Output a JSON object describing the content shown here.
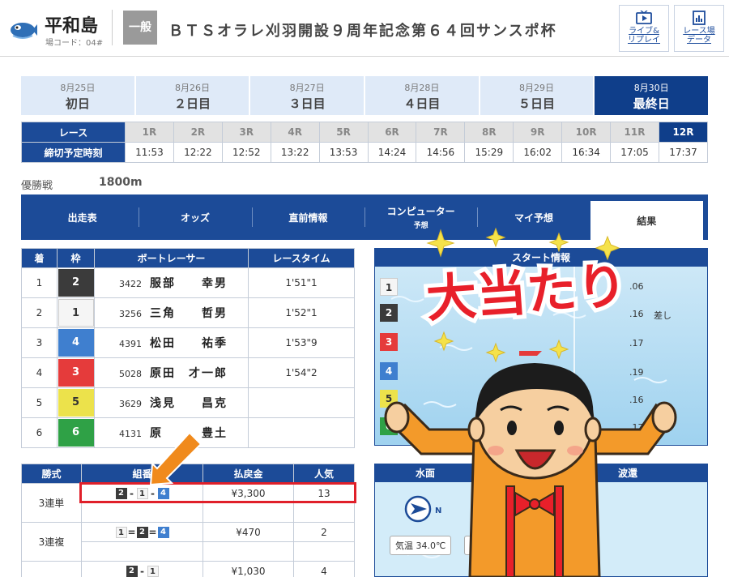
{
  "header": {
    "venue_name": "平和島",
    "venue_code": "場コード：04#",
    "grade": "一般",
    "race_title": "ＢＴＳオラレ刈羽開設９周年記念第６４回サンスポ杯",
    "buttons": [
      {
        "label_line1": "ライブ&",
        "label_line2": "リプレイ",
        "icon": "tv-icon"
      },
      {
        "label_line1": "レース場",
        "label_line2": "データ",
        "icon": "chart-icon"
      }
    ]
  },
  "days": [
    {
      "date": "8月25日",
      "name": "初日",
      "active": false
    },
    {
      "date": "8月26日",
      "name": "２日目",
      "active": false
    },
    {
      "date": "8月27日",
      "name": "３日目",
      "active": false
    },
    {
      "date": "8月28日",
      "name": "４日目",
      "active": false
    },
    {
      "date": "8月29日",
      "name": "５日目",
      "active": false
    },
    {
      "date": "8月30日",
      "name": "最終日",
      "active": true
    }
  ],
  "race_table": {
    "race_label": "レース",
    "deadline_label": "締切予定時刻",
    "races": [
      "1R",
      "2R",
      "3R",
      "4R",
      "5R",
      "6R",
      "7R",
      "8R",
      "9R",
      "10R",
      "11R",
      "12R"
    ],
    "times": [
      "11:53",
      "12:22",
      "12:52",
      "13:22",
      "13:53",
      "14:24",
      "14:56",
      "15:29",
      "16:02",
      "16:34",
      "17:05",
      "17:37"
    ],
    "active_index": 11
  },
  "final": {
    "label": "優勝戦",
    "distance": "1800m"
  },
  "tabs": [
    {
      "label": "出走表",
      "sub": ""
    },
    {
      "label": "オッズ",
      "sub": ""
    },
    {
      "label": "直前情報",
      "sub": ""
    },
    {
      "label": "コンピューター",
      "sub": "予想"
    },
    {
      "label": "マイ予想",
      "sub": ""
    },
    {
      "label": "結果",
      "sub": "",
      "active": true
    }
  ],
  "results": {
    "headers": [
      "着",
      "枠",
      "ボートレーサー",
      "レースタイム"
    ],
    "rows": [
      {
        "place": "1",
        "frame": "2",
        "reg": "3422",
        "name": "服部　　幸男",
        "time": "1'51\"1"
      },
      {
        "place": "2",
        "frame": "1",
        "reg": "3256",
        "name": "三角　　哲男",
        "time": "1'52\"1"
      },
      {
        "place": "3",
        "frame": "4",
        "reg": "4391",
        "name": "松田　　祐季",
        "time": "1'53\"9"
      },
      {
        "place": "4",
        "frame": "3",
        "reg": "5028",
        "name": "原田　才一郎",
        "time": "1'54\"2"
      },
      {
        "place": "5",
        "frame": "5",
        "reg": "3629",
        "name": "浅見　　昌克",
        "time": ""
      },
      {
        "place": "6",
        "frame": "6",
        "reg": "4131",
        "name": "原　　　豊土",
        "time": ""
      }
    ]
  },
  "start_info": {
    "header": "スタート情報",
    "rows": [
      {
        "frame": "1",
        "value": ".06",
        "note": ""
      },
      {
        "frame": "2",
        "value": ".16",
        "note": "差し"
      },
      {
        "frame": "3",
        "value": ".17",
        "note": ""
      },
      {
        "frame": "4",
        "value": ".19",
        "note": ""
      },
      {
        "frame": "5",
        "value": ".16",
        "note": ""
      },
      {
        "frame": "6",
        "value": ".17",
        "note": ""
      }
    ]
  },
  "payout": {
    "headers": [
      "勝式",
      "組番",
      "払戻金",
      "人気"
    ],
    "rows": [
      {
        "kind": "3連単",
        "combo": [
          "2",
          "1",
          "4"
        ],
        "ops": [
          "-",
          "-"
        ],
        "amount": "¥3,300",
        "pop": "13"
      },
      {
        "kind": "3連複",
        "combo": [
          "1",
          "2",
          "4"
        ],
        "ops": [
          "=",
          "="
        ],
        "amount": "¥470",
        "pop": "2"
      },
      {
        "kind": "",
        "combo": [
          "2",
          "1"
        ],
        "ops": [
          "-"
        ],
        "amount": "¥1,030",
        "pop": "4"
      }
    ]
  },
  "weather": {
    "header_a": "水面",
    "header_b": "波還",
    "compass_label": "N",
    "temperature": "気温 34.0℃"
  },
  "overlay": {
    "banner_text": "大当たり"
  }
}
